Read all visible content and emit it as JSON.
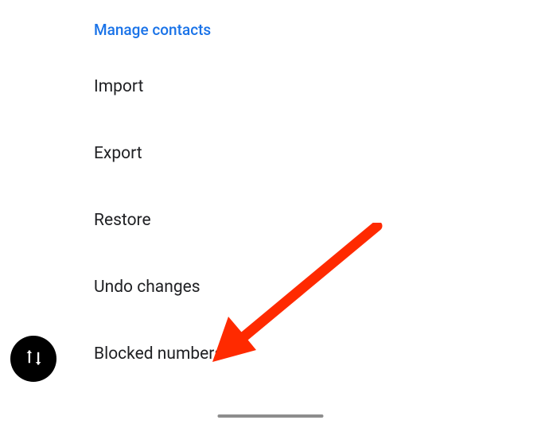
{
  "section": {
    "header": "Manage contacts",
    "items": [
      {
        "label": "Import"
      },
      {
        "label": "Export"
      },
      {
        "label": "Restore"
      },
      {
        "label": "Undo changes"
      },
      {
        "label": "Blocked numbers"
      }
    ]
  }
}
